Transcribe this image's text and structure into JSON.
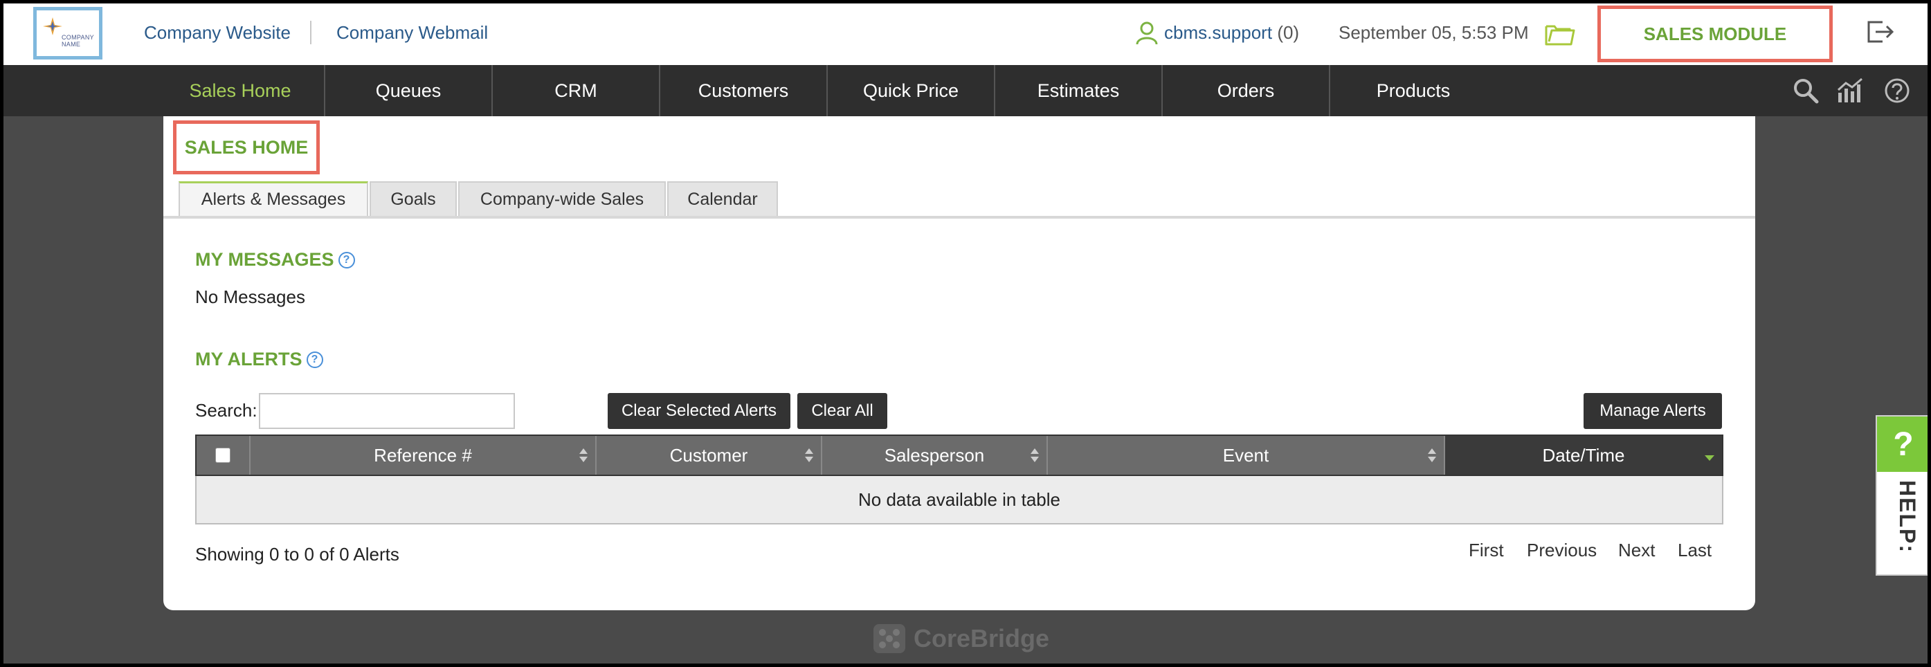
{
  "header": {
    "logo_text": "COMPANY NAME",
    "links": [
      "Company Website",
      "Company Webmail"
    ],
    "user": "cbms.support",
    "user_count": "(0)",
    "datetime": "September 05, 5:53 PM",
    "module_label": "SALES MODULE"
  },
  "nav": {
    "items": [
      "Sales Home",
      "Queues",
      "CRM",
      "Customers",
      "Quick Price",
      "Estimates",
      "Orders",
      "Products"
    ],
    "active": "Sales Home",
    "icons": [
      "search-icon",
      "chart-icon",
      "help-icon"
    ]
  },
  "page": {
    "title": "SALES HOME",
    "tabs": [
      "Alerts & Messages",
      "Goals",
      "Company-wide Sales",
      "Calendar"
    ],
    "active_tab": "Alerts & Messages",
    "messages_heading": "MY MESSAGES",
    "messages_text": "No Messages",
    "alerts_heading": "MY ALERTS",
    "search_label": "Search:",
    "search_value": "",
    "clear_selected_label": "Clear Selected Alerts",
    "clear_all_label": "Clear All",
    "manage_label": "Manage Alerts",
    "table": {
      "columns": [
        "Reference #",
        "Customer",
        "Salesperson",
        "Event",
        "Date/Time"
      ],
      "sorted_column": "Date/Time",
      "empty_text": "No data available in table"
    },
    "showing_text": "Showing 0 to 0 of 0 Alerts",
    "pager": [
      "First",
      "Previous",
      "Next",
      "Last"
    ]
  },
  "footer": {
    "brand": "CoreBridge"
  },
  "help_tab": {
    "symbol": "?",
    "label": "HELP:"
  },
  "colors": {
    "accent_green": "#6aa338",
    "highlight_red": "#e8695c",
    "nav_bg": "#2e2e2e"
  }
}
